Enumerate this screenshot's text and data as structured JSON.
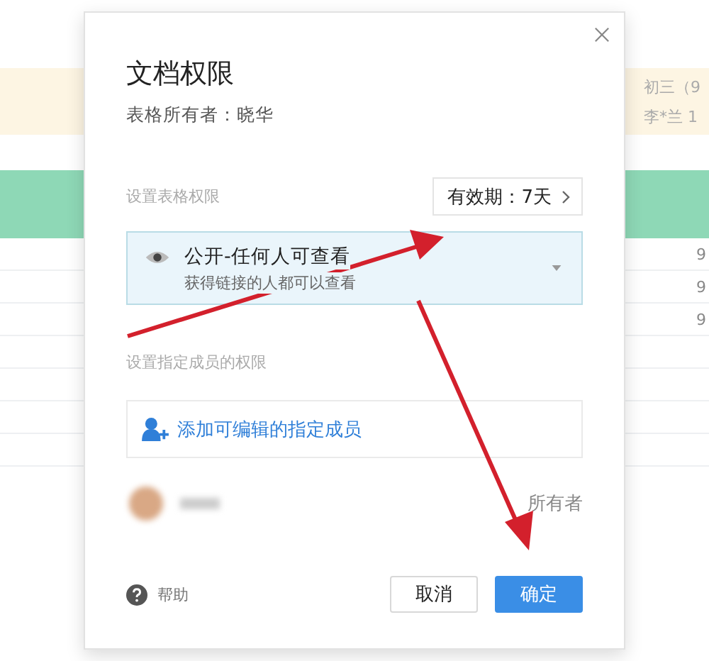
{
  "background": {
    "banner_rows": [
      "初三（9",
      "李*兰 1"
    ],
    "cells": [
      "9",
      "9",
      "9"
    ]
  },
  "dialog": {
    "title": "文档权限",
    "owner": "表格所有者：晓华",
    "table_permission_label": "设置表格权限",
    "validity": "有效期：7天",
    "access": {
      "title": "公开-任何人可查看",
      "description": "获得链接的人都可以查看"
    },
    "member_label": "设置指定成员的权限",
    "add_member": "添加可编辑的指定成员",
    "members": [
      {
        "role": "所有者"
      }
    ],
    "help": "帮助",
    "buttons": [
      {
        "label": "取消",
        "kind": "secondary"
      },
      {
        "label": "确定",
        "kind": "primary"
      }
    ]
  }
}
